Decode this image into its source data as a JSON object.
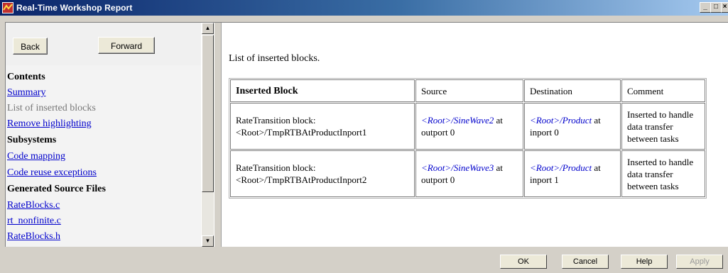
{
  "window": {
    "title": "Real-Time Workshop Report",
    "controls": {
      "minimize": "_",
      "maximize": "□",
      "close": "×"
    }
  },
  "nav": {
    "back": "Back",
    "forward": "Forward"
  },
  "toc": {
    "contents_heading": "Contents",
    "summary": "Summary",
    "inserted_blocks": "List of inserted blocks",
    "remove_highlighting": "Remove highlighting",
    "subsystems_heading": "Subsystems",
    "code_mapping": "Code mapping",
    "code_reuse": "Code reuse exceptions",
    "generated_heading": "Generated Source Files",
    "files": [
      "RateBlocks.c",
      "rt_nonfinite.c",
      "RateBlocks.h"
    ]
  },
  "report": {
    "intro": "List of inserted blocks.",
    "columns": [
      "Inserted Block",
      "Source",
      "Destination",
      "Comment"
    ],
    "rows": [
      {
        "block_line1": "RateTransition block:",
        "block_line2": "<Root>/TmpRTBAtProductInport1",
        "source_link": "<Root>/SineWave2",
        "source_at": " at",
        "source_port": "outport 0",
        "dest_link": "<Root>/Product",
        "dest_at": " at",
        "dest_port": "inport 0",
        "comment_line1": "Inserted to handle",
        "comment_line2": "data transfer",
        "comment_line3": "between tasks"
      },
      {
        "block_line1": "RateTransition block:",
        "block_line2": "<Root>/TmpRTBAtProductInport2",
        "source_link": "<Root>/SineWave3",
        "source_at": " at",
        "source_port": "outport 0",
        "dest_link": "<Root>/Product",
        "dest_at": " at",
        "dest_port": "inport 1",
        "comment_line1": "Inserted to handle",
        "comment_line2": "data transfer",
        "comment_line3": "between tasks"
      }
    ]
  },
  "buttons": {
    "ok": "OK",
    "cancel": "Cancel",
    "help": "Help",
    "apply": "Apply"
  },
  "colors": {
    "link": "#0000cc",
    "visited": "#777777",
    "titlebar_start": "#0a246a",
    "titlebar_end": "#a6caf0"
  }
}
